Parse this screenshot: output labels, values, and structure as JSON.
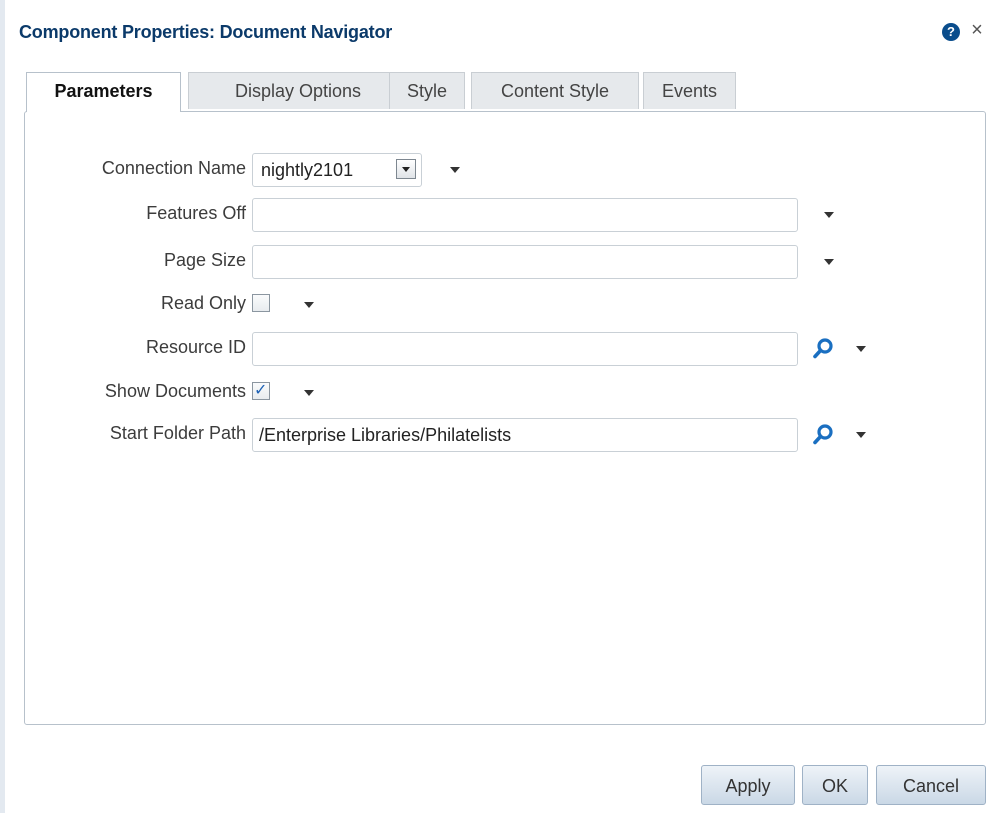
{
  "dialog": {
    "title": "Component Properties: Document Navigator",
    "help_icon_glyph": "?",
    "close_icon_glyph": "×"
  },
  "tabs": [
    {
      "label": "Parameters",
      "active": true
    },
    {
      "label": "Display Options",
      "active": false
    },
    {
      "label": "Style",
      "active": false
    },
    {
      "label": "Content Style",
      "active": false
    },
    {
      "label": "Events",
      "active": false
    }
  ],
  "fields": {
    "connection_name": {
      "label": "Connection Name",
      "value": "nightly2101"
    },
    "features_off": {
      "label": "Features Off",
      "value": ""
    },
    "page_size": {
      "label": "Page Size",
      "value": ""
    },
    "read_only": {
      "label": "Read Only",
      "checked": false
    },
    "resource_id": {
      "label": "Resource ID",
      "value": ""
    },
    "show_documents": {
      "label": "Show Documents",
      "checked": true
    },
    "start_folder_path": {
      "label": "Start Folder Path",
      "value": "/Enterprise Libraries/Philatelists"
    }
  },
  "buttons": {
    "apply": "Apply",
    "ok": "OK",
    "cancel": "Cancel"
  },
  "colors": {
    "title": "#0b3a6a",
    "search_icon": "#1a6fc1",
    "checkmark": "#1f62b5",
    "button_gradient_top": "#eef3f8",
    "button_gradient_bottom": "#cad8e6"
  }
}
